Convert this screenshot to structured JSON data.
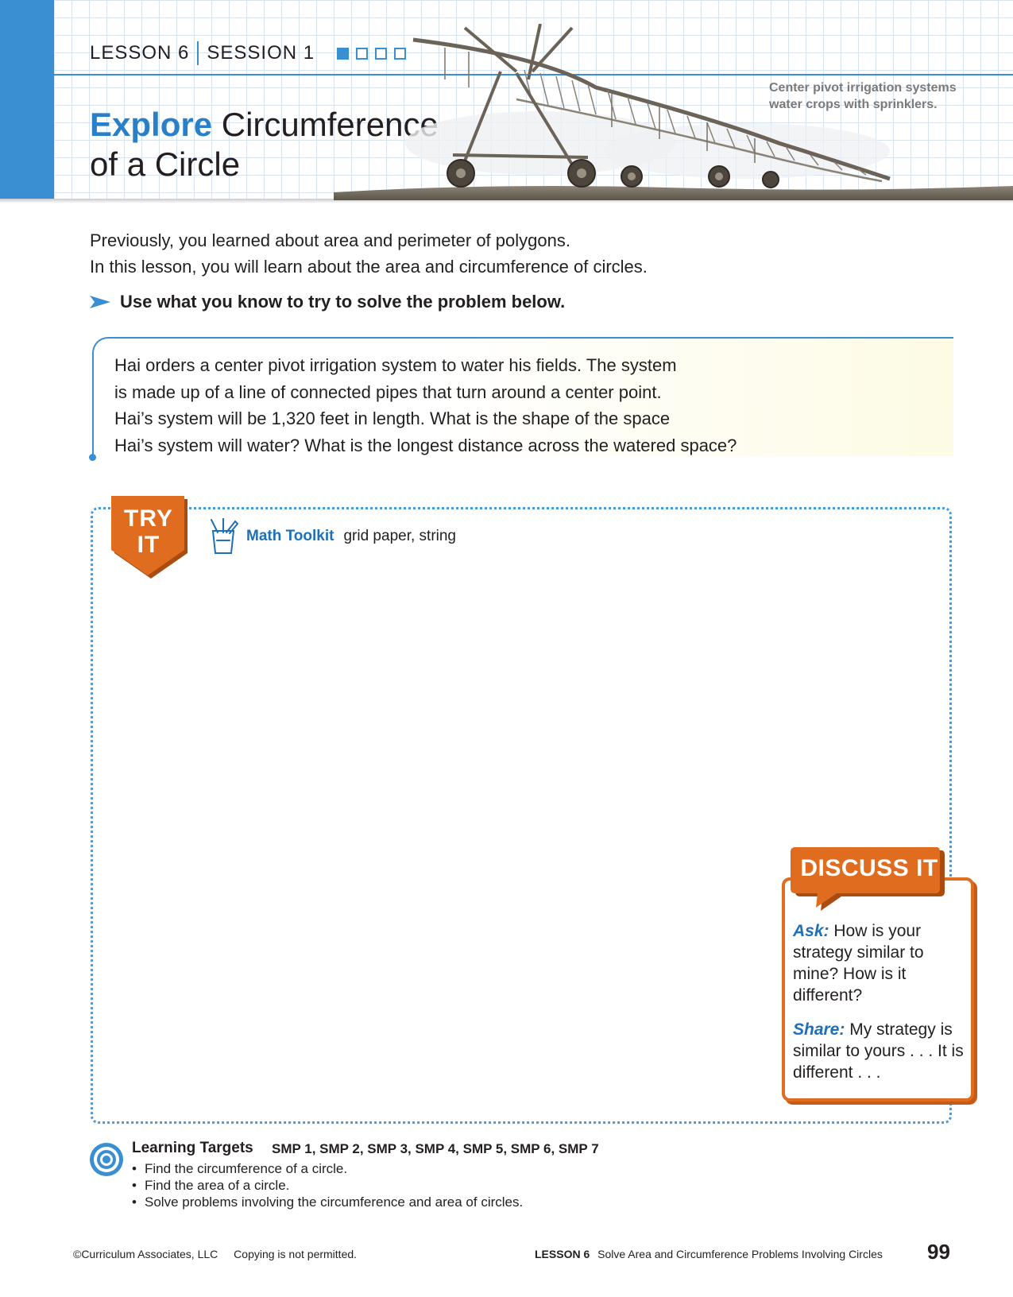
{
  "header": {
    "lesson": "LESSON 6",
    "session": "SESSION 1",
    "session_progress": {
      "total": 4,
      "completed": 1
    },
    "title_highlight": "Explore",
    "title_rest_line1": "Circumference",
    "title_rest_line2": "of a Circle",
    "photo_caption_line1": "Center pivot irrigation systems",
    "photo_caption_line2": "water crops with sprinklers."
  },
  "intro": {
    "line1": "Previously, you learned about area and perimeter of polygons.",
    "line2": "In this lesson, you will learn about the area and circumference of circles.",
    "instruction": "Use what you know to try to solve the problem below."
  },
  "problem": {
    "line1": "Hai orders a center pivot irrigation system to water his fields. The system",
    "line2": "is made up of a line of connected pipes that turn around a center point.",
    "line3": "Hai’s system will be 1,320 feet in length. What is the shape of the space",
    "line4": "Hai’s system will water? What is the longest distance across the watered space?"
  },
  "try_it": {
    "badge_line1": "TRY",
    "badge_line2": "IT",
    "toolkit_label": "Math Toolkit",
    "toolkit_items": "grid paper, string"
  },
  "discuss_it": {
    "title": "DISCUSS IT",
    "ask_label": "Ask:",
    "ask_text": "How is your strategy similar to mine? How is it different?",
    "share_label": "Share:",
    "share_text": "My strategy is similar to yours . . . It is different . . ."
  },
  "learning_targets": {
    "heading": "Learning Targets",
    "smp": "SMP 1, SMP 2, SMP 3, SMP 4, SMP 5, SMP 6, SMP 7",
    "items": [
      "Find the circumference of a circle.",
      "Find the area of a circle.",
      "Solve problems involving the circumference and area of circles."
    ]
  },
  "footer": {
    "copyright": "©Curriculum Associates, LLC",
    "notice": "Copying is not permitted.",
    "lesson": "LESSON 6",
    "lesson_title": "Solve Area and Circumference Problems Involving Circles",
    "page_number": "99"
  },
  "colors": {
    "brand_blue": "#3a8fd3",
    "link_blue": "#1d70b7",
    "orange": "#e06c1f"
  }
}
